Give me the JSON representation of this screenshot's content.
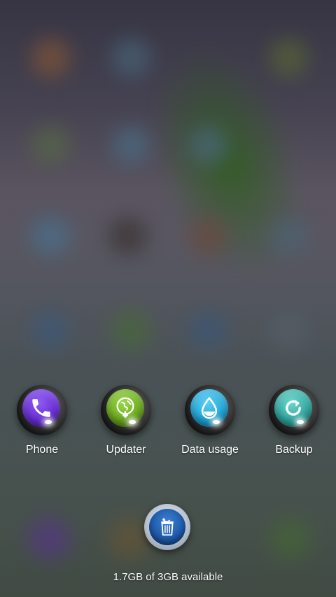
{
  "apps": [
    {
      "label": "Phone",
      "icon": "phone-icon",
      "color": "#6a2ed8"
    },
    {
      "label": "Updater",
      "icon": "globe-download-icon",
      "color": "#6cab1e"
    },
    {
      "label": "Data usage",
      "icon": "water-drop-icon",
      "color": "#1ea6d8"
    },
    {
      "label": "Backup",
      "icon": "refresh-icon",
      "color": "#2fa8a0"
    }
  ],
  "cleaner": {
    "icon": "trash-icon",
    "color": "#1d58a8"
  },
  "memory_status": "1.7GB of 3GB available"
}
